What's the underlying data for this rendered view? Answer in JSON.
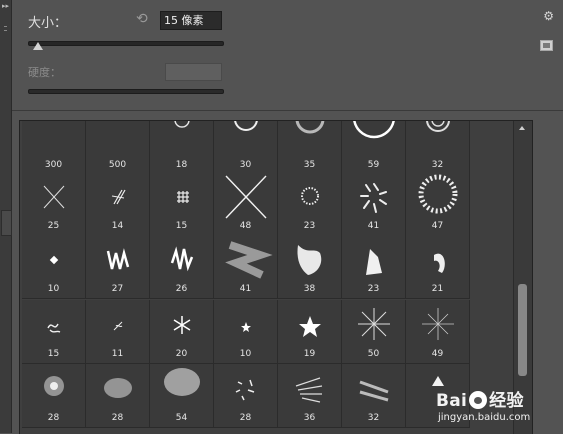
{
  "size": {
    "label": "大小：",
    "value": "15 像素",
    "slider_fraction": 0.05
  },
  "hardness": {
    "label": "硬度：",
    "value": ""
  },
  "brushes": [
    {
      "num": "300",
      "shape": "soft-big"
    },
    {
      "num": "500",
      "shape": "soft-big"
    },
    {
      "num": "18",
      "shape": "ring-s"
    },
    {
      "num": "30",
      "shape": "ring-m"
    },
    {
      "num": "35",
      "shape": "ring-fuzzy"
    },
    {
      "num": "59",
      "shape": "ring-l"
    },
    {
      "num": "32",
      "shape": "ring-double"
    },
    {
      "num": "25",
      "shape": "x-thin"
    },
    {
      "num": "14",
      "shape": "hatch"
    },
    {
      "num": "15",
      "shape": "grid-hash"
    },
    {
      "num": "48",
      "shape": "x-big"
    },
    {
      "num": "23",
      "shape": "dot-ring"
    },
    {
      "num": "41",
      "shape": "swirl"
    },
    {
      "num": "47",
      "shape": "dash-ring"
    },
    {
      "num": "10",
      "shape": "diamond"
    },
    {
      "num": "27",
      "shape": "zigzag"
    },
    {
      "num": "26",
      "shape": "zigzag-b"
    },
    {
      "num": "41",
      "shape": "blur-z"
    },
    {
      "num": "38",
      "shape": "blob"
    },
    {
      "num": "23",
      "shape": "chunk"
    },
    {
      "num": "21",
      "shape": "curl"
    },
    {
      "num": "15",
      "shape": "squiggle"
    },
    {
      "num": "11",
      "shape": "slash-small"
    },
    {
      "num": "20",
      "shape": "snowflake"
    },
    {
      "num": "10",
      "shape": "star-s"
    },
    {
      "num": "19",
      "shape": "star-m"
    },
    {
      "num": "50",
      "shape": "burst"
    },
    {
      "num": "49",
      "shape": "burst-thin"
    },
    {
      "num": "28",
      "shape": "speckle"
    },
    {
      "num": "28",
      "shape": "fiber"
    },
    {
      "num": "54",
      "shape": "sponge"
    },
    {
      "num": "28",
      "shape": "scatter"
    },
    {
      "num": "36",
      "shape": "grass"
    },
    {
      "num": "32",
      "shape": "streak"
    },
    {
      "num": "",
      "shape": "triangle"
    }
  ],
  "watermark": {
    "logo_a": "Bai",
    "logo_b": "经验",
    "url": "jingyan.baidu.com"
  }
}
